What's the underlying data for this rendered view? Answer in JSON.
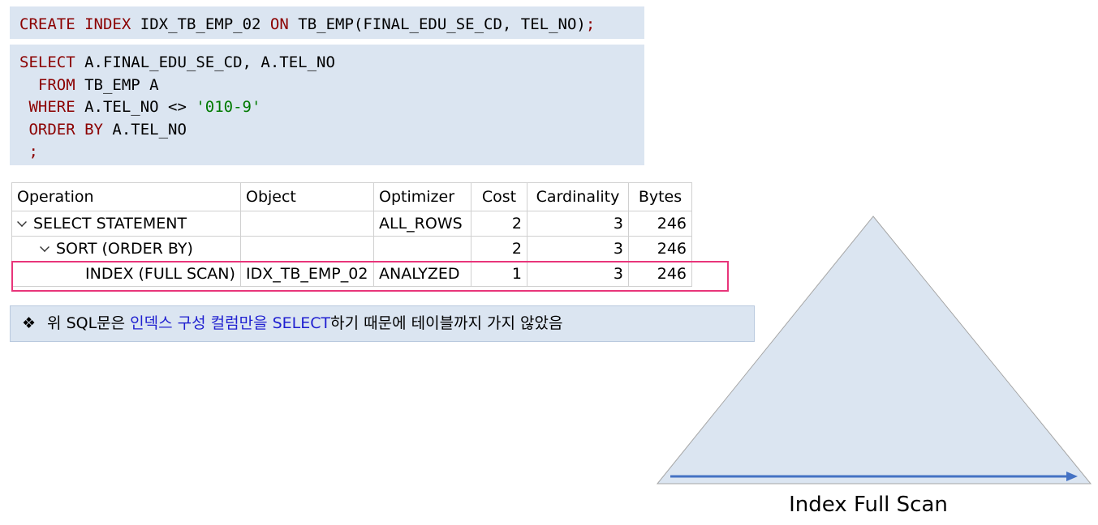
{
  "create_sql": {
    "kw_create": "CREATE",
    "kw_index": "INDEX",
    "index_name": "IDX_TB_EMP_02",
    "kw_on": "ON",
    "table_cols": "TB_EMP(FINAL_EDU_SE_CD, TEL_NO)",
    "semicolon": ";"
  },
  "select_sql": {
    "line1_kw": "SELECT",
    "line1_rest": " A.FINAL_EDU_SE_CD, A.TEL_NO",
    "line2_kw": "  FROM",
    "line2_rest": " TB_EMP A",
    "line3_kw": " WHERE",
    "line3_rest": " A.TEL_NO <> ",
    "line3_str": "'010-9'",
    "line4_kw": " ORDER BY",
    "line4_rest": " A.TEL_NO",
    "line5": " ;"
  },
  "plan_table": {
    "headers": [
      "Operation",
      "Object",
      "Optimizer",
      "Cost",
      "Cardinality",
      "Bytes"
    ],
    "rows": [
      {
        "operation": "SELECT STATEMENT",
        "object": "",
        "optimizer": "ALL_ROWS",
        "cost": "2",
        "cardinality": "3",
        "bytes": "246"
      },
      {
        "operation": "SORT (ORDER BY)",
        "object": "",
        "optimizer": "",
        "cost": "2",
        "cardinality": "3",
        "bytes": "246"
      },
      {
        "operation": "INDEX (FULL SCAN)",
        "object": "IDX_TB_EMP_02",
        "optimizer": "ANALYZED",
        "cost": "1",
        "cardinality": "3",
        "bytes": "246"
      }
    ]
  },
  "note": {
    "bullet": "❖",
    "prefix": "위 SQL문은 ",
    "highlight": "인덱스 구성 컬럼만을 SELECT",
    "suffix": "하기 때문에 테이블까지 가지 않았음"
  },
  "diagram": {
    "caption": "Index Full Scan",
    "fill_color": "#dbe5f1",
    "arrow_color": "#4472c4"
  }
}
